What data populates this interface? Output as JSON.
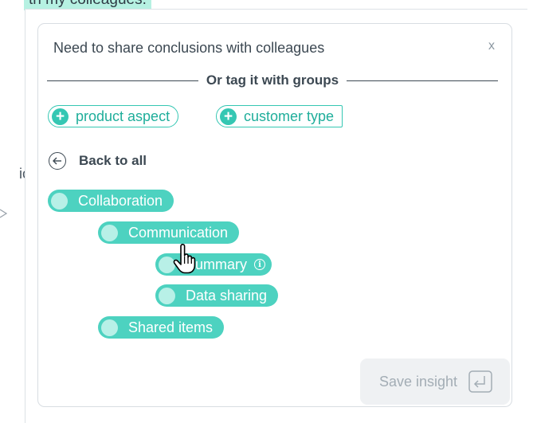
{
  "background": {
    "highlighted_text": "th my colleagues.",
    "side_text": "io"
  },
  "card": {
    "title": "Need to share conclusions with colleagues",
    "close_label": "x",
    "divider_text": "Or tag it with groups",
    "tag_groups": [
      {
        "label": "product aspect"
      },
      {
        "label": "customer type"
      }
    ],
    "back_label": "Back to all",
    "tags": [
      {
        "label": "Collaboration"
      },
      {
        "label": "Communication"
      },
      {
        "label": "Summary",
        "info_icon": "info-icon",
        "info_glyph": "i"
      },
      {
        "label": "Data sharing"
      },
      {
        "label": "Shared items"
      }
    ],
    "save_label": "Save insight",
    "plus_glyph": "+"
  },
  "colors": {
    "accent": "#4dd2c0",
    "accent_dark": "#1fae9b",
    "highlight": "#b6f1e2",
    "text": "#3c4852",
    "button_bg": "#eff1f3"
  },
  "icons": [
    "close-icon",
    "plus-icon",
    "back-arrow-icon",
    "info-icon",
    "hand-pointer-icon",
    "enter-icon"
  ]
}
